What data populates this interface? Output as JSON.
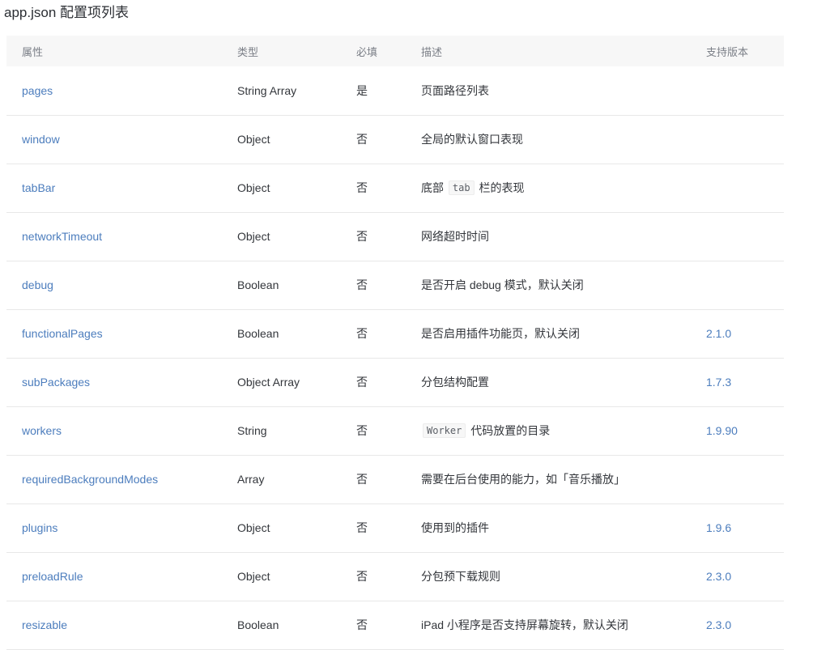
{
  "page": {
    "title": "app.json 配置项列表"
  },
  "table": {
    "headers": [
      {
        "key": "property",
        "label": "属性"
      },
      {
        "key": "type",
        "label": "类型"
      },
      {
        "key": "required",
        "label": "必填"
      },
      {
        "key": "description",
        "label": "描述"
      },
      {
        "key": "version",
        "label": "支持版本"
      }
    ],
    "rows": [
      {
        "property": "pages",
        "type": "String Array",
        "required": "是",
        "description": [
          {
            "t": "页面路径列表"
          }
        ],
        "version": ""
      },
      {
        "property": "window",
        "type": "Object",
        "required": "否",
        "description": [
          {
            "t": "全局的默认窗口表现"
          }
        ],
        "version": ""
      },
      {
        "property": "tabBar",
        "type": "Object",
        "required": "否",
        "description": [
          {
            "t": "底部 "
          },
          {
            "t": "tab",
            "code": true
          },
          {
            "t": " 栏的表现"
          }
        ],
        "version": ""
      },
      {
        "property": "networkTimeout",
        "type": "Object",
        "required": "否",
        "description": [
          {
            "t": "网络超时时间"
          }
        ],
        "version": ""
      },
      {
        "property": "debug",
        "type": "Boolean",
        "required": "否",
        "description": [
          {
            "t": "是否开启 debug 模式，默认关闭"
          }
        ],
        "version": ""
      },
      {
        "property": "functionalPages",
        "type": "Boolean",
        "required": "否",
        "description": [
          {
            "t": "是否启用插件功能页，默认关闭"
          }
        ],
        "version": "2.1.0"
      },
      {
        "property": "subPackages",
        "type": "Object Array",
        "required": "否",
        "description": [
          {
            "t": "分包结构配置"
          }
        ],
        "version": "1.7.3"
      },
      {
        "property": "workers",
        "type": "String",
        "required": "否",
        "description": [
          {
            "t": "Worker",
            "code": true
          },
          {
            "t": " 代码放置的目录"
          }
        ],
        "version": "1.9.90"
      },
      {
        "property": "requiredBackgroundModes",
        "type": "Array",
        "required": "否",
        "description": [
          {
            "t": "需要在后台使用的能力，如「音乐播放」"
          }
        ],
        "version": ""
      },
      {
        "property": "plugins",
        "type": "Object",
        "required": "否",
        "description": [
          {
            "t": "使用到的插件"
          }
        ],
        "version": "1.9.6"
      },
      {
        "property": "preloadRule",
        "type": "Object",
        "required": "否",
        "description": [
          {
            "t": "分包预下载规则"
          }
        ],
        "version": "2.3.0"
      },
      {
        "property": "resizable",
        "type": "Boolean",
        "required": "否",
        "description": [
          {
            "t": "iPad 小程序是否支持屏幕旋转，默认关闭"
          }
        ],
        "version": "2.3.0"
      }
    ]
  },
  "colors": {
    "link": "#4c7dbd",
    "header_bg": "#f7f7f7",
    "header_text": "#7b7f87",
    "text": "#33363b",
    "title": "#2b2e33",
    "border": "#e8e8e8",
    "code_bg": "#f7f7f7",
    "code_text": "#5b5f66",
    "code_border": "#ececec"
  }
}
